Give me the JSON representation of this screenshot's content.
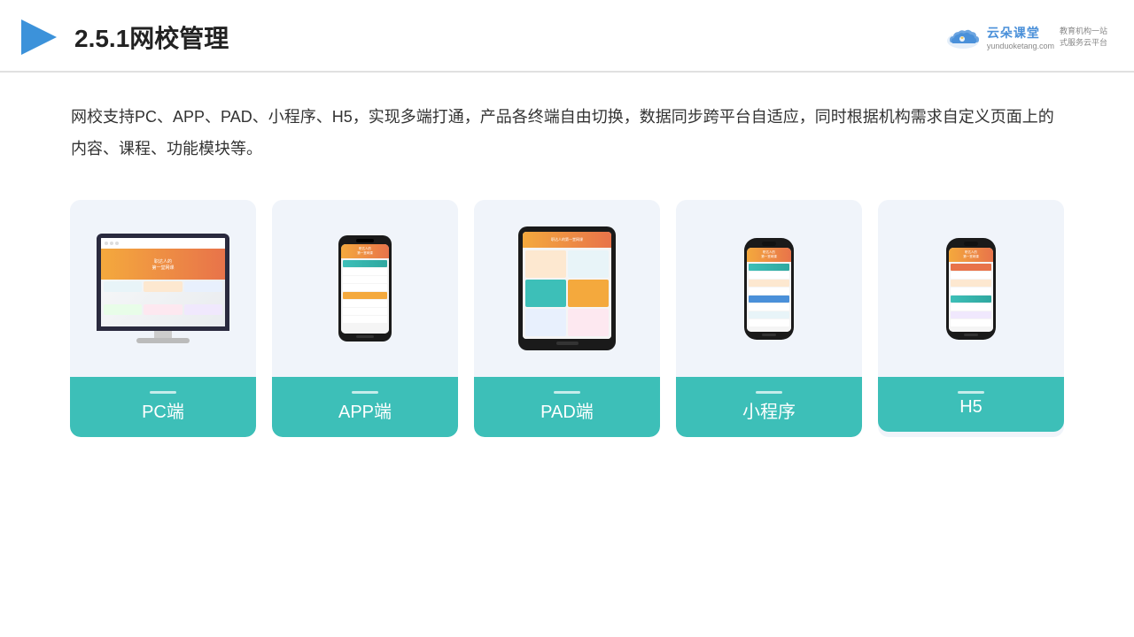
{
  "header": {
    "title": "2.5.1网校管理",
    "logo_name": "云朵课堂",
    "logo_url": "yunduoketang.com",
    "logo_tagline": "教育机构一站\n式服务云平台"
  },
  "description": "网校支持PC、APP、PAD、小程序、H5，实现多端打通，产品各终端自由切换，数据同步跨平台自适应，同时根据机构需求自定义页面上的内容、课程、功能模块等。",
  "cards": [
    {
      "id": "pc",
      "label": "PC端"
    },
    {
      "id": "app",
      "label": "APP端"
    },
    {
      "id": "pad",
      "label": "PAD端"
    },
    {
      "id": "miniapp",
      "label": "小程序"
    },
    {
      "id": "h5",
      "label": "H5"
    }
  ]
}
